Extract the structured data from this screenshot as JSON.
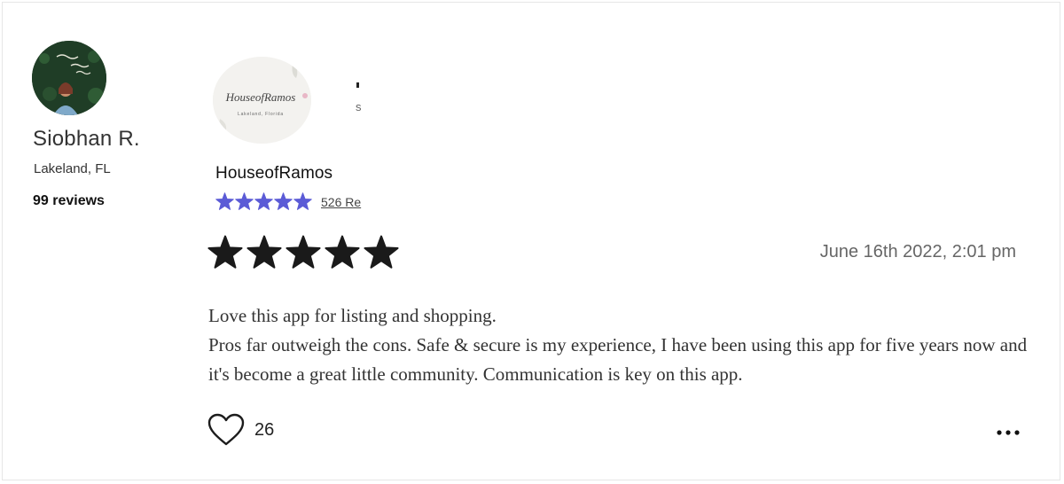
{
  "reviewer": {
    "name": "Siobhan R.",
    "location": "Lakeland, FL",
    "review_count": "99 reviews"
  },
  "business": {
    "logo_text": "HouseofRamos",
    "logo_subtext": "Lakeland, Florida",
    "name": "HouseofRamos",
    "star_count": 5,
    "reviews_link": "526 Re",
    "star_color": "#5b5bd6"
  },
  "review": {
    "star_count": 5,
    "star_color": "#1a1a1a",
    "date": "June 16th 2022, 2:01 pm",
    "lines": [
      "Love this app for listing and shopping.",
      "Pros far outweigh the cons. Safe & secure is my experience, I have been using this app for five years now and it's become a great little community. Communication is key on this app."
    ]
  },
  "actions": {
    "like_count": "26",
    "like_icon": "heart-outline-icon",
    "more_icon": "ellipsis-icon"
  }
}
